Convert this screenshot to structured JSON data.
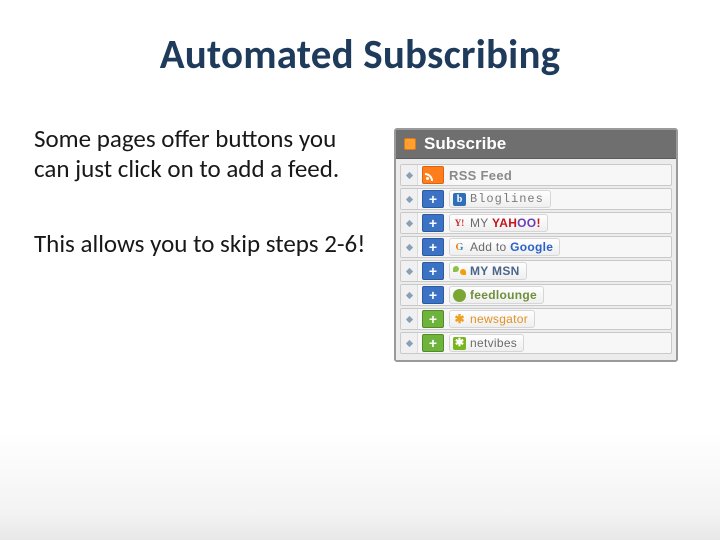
{
  "slide": {
    "title": "Automated Subscribing",
    "para1": "Some pages offer buttons you can just click on to add a feed.",
    "para2": "This allows you to skip steps 2-6!"
  },
  "widget": {
    "heading": "Subscribe",
    "rows": [
      {
        "id": "rss",
        "lead": "rss",
        "icon": "none",
        "label": "RSS Feed"
      },
      {
        "id": "bloglines",
        "lead": "plusblue",
        "icon": "bloglines",
        "label": "Bloglines"
      },
      {
        "id": "yahoo",
        "lead": "plusblue",
        "icon": "yahoo",
        "label_html": "MY <span class='accent-yahoo'>YAH<span class='oo'>OO</span>!</span>"
      },
      {
        "id": "google",
        "lead": "plusblue",
        "icon": "google",
        "label_html": "Add to <span class='google-g'>Google</span>"
      },
      {
        "id": "msn",
        "lead": "plusblue",
        "icon": "msn",
        "label": "MY MSN"
      },
      {
        "id": "feedlounge",
        "lead": "plusblue",
        "icon": "feedlounge",
        "label": "feedlounge"
      },
      {
        "id": "newsgator",
        "lead": "plusgreen",
        "icon": "newsgator",
        "label": "newsgator"
      },
      {
        "id": "netvibes",
        "lead": "plusgreen",
        "icon": "netvibes",
        "label": "netvibes"
      }
    ]
  }
}
